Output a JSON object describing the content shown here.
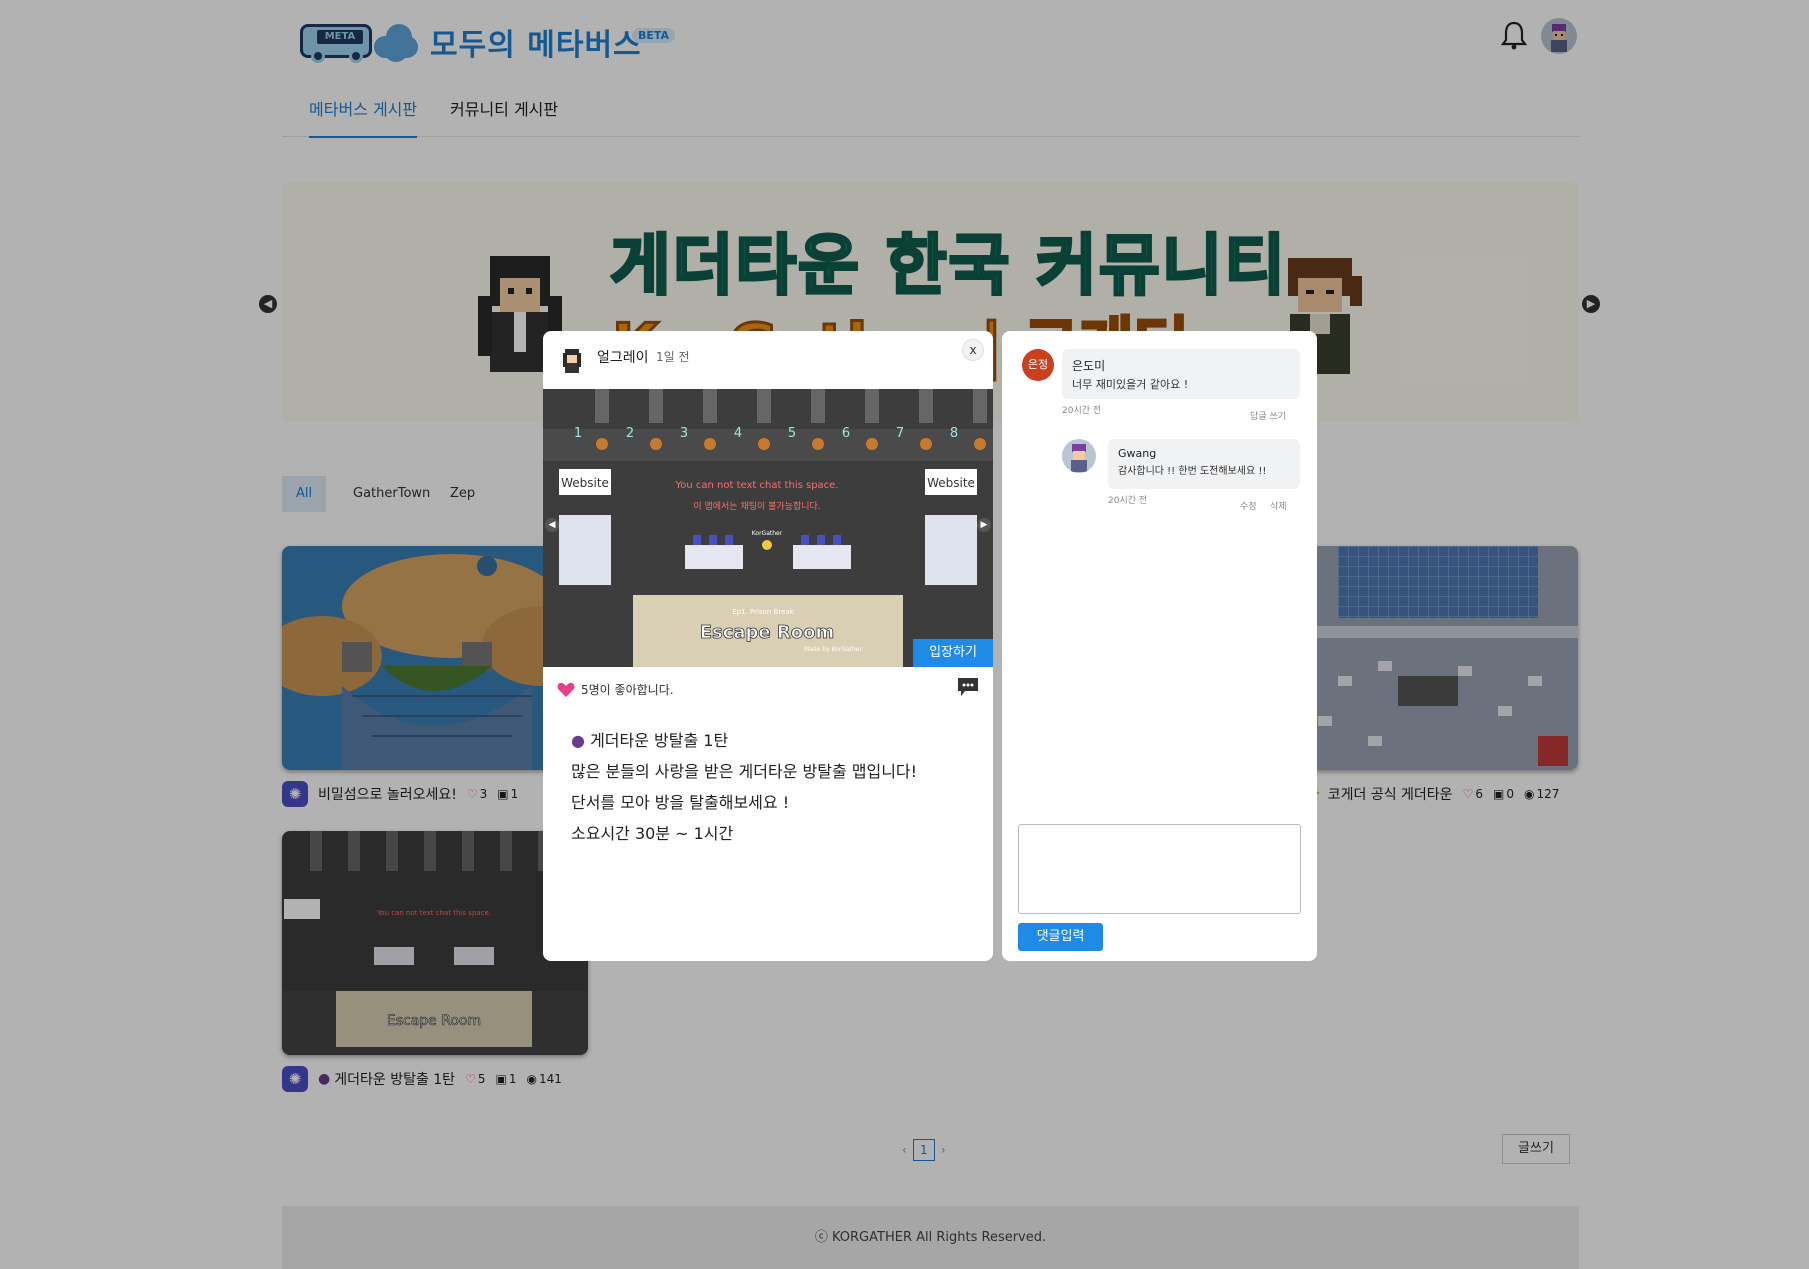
{
  "colors": {
    "accent": "#1f7fd1",
    "button_blue": "#1f8be6",
    "overlay": "rgba(0,0,0,0.30)",
    "like_pink": "#e83e8c"
  },
  "header": {
    "logo_sign": "META",
    "site_title": "모두의 메타버스",
    "beta_badge": "BETA",
    "icons": [
      "bell-icon",
      "user-avatar"
    ]
  },
  "nav": {
    "tabs": [
      {
        "label": "메타버스 게시판",
        "active": true
      },
      {
        "label": "커뮤니티 게시판",
        "active": false
      }
    ]
  },
  "banner": {
    "title": "게더타운 한국 커뮤니티",
    "subtitle": "KorGather | 코게더"
  },
  "filters": [
    {
      "label": "All",
      "active": true
    },
    {
      "label": "GatherTown",
      "active": false
    },
    {
      "label": "Zep",
      "active": false
    }
  ],
  "cards": [
    {
      "title": "비밀섬으로 놀러오세요!",
      "likes": "3",
      "comments": "1",
      "platform_icon": "gathertown-icon"
    },
    {
      "title": "코게더 공식 게더타운",
      "likes": "6",
      "comments": "0",
      "views": "127",
      "platform_icon": "gathertown-icon"
    },
    {
      "title": "게더타운 방탈출 1탄",
      "likes": "5",
      "comments": "1",
      "views": "141",
      "platform_icon": "gathertown-icon"
    }
  ],
  "pagination": {
    "current": "1",
    "prev": "‹",
    "next": "›"
  },
  "write_button": "글쓰기",
  "footer": {
    "copyright": "ⓒ KORGATHER All Rights Reserved."
  },
  "post_modal": {
    "author": "얼그레이",
    "time": "1일 전",
    "close_label": "x",
    "enter_button": "입장하기",
    "media": {
      "room_numbers": [
        "1",
        "2",
        "3",
        "4",
        "5",
        "6",
        "7",
        "8"
      ],
      "website_sign": "Website",
      "notice_line1": "You can not text chat this space.",
      "notice_line2": "이 맵에서는 채팅이 불가능합니다.",
      "banner_small": "Ep1. Prison Break",
      "banner_title": "Escape Room",
      "banner_credit": "Made by KorGather",
      "player_tag": "KorGather"
    },
    "likes_text": "5명이 좋아합니다.",
    "body_lines": [
      "게더타운 방탈출 1탄",
      "많은 분들의 사랑을 받은 게더타운 방탈출 맵입니다!",
      "단서를 모아 방을 탈출해보세요 !",
      "소요시간 30분 ~ 1시간"
    ]
  },
  "comments_panel": {
    "comments": [
      {
        "avatar_text": "은정",
        "name": "은도미",
        "text": "너무 재미있을거 같아요 !",
        "time": "20시간 전",
        "action": "답글 쓰기"
      },
      {
        "name": "Gwang",
        "text": "감사합니다 !! 한번 도전해보세요 !!",
        "time": "20시간 전",
        "actions": [
          "수정",
          "삭제"
        ]
      }
    ],
    "input_placeholder": "",
    "submit_label": "댓글입력"
  }
}
